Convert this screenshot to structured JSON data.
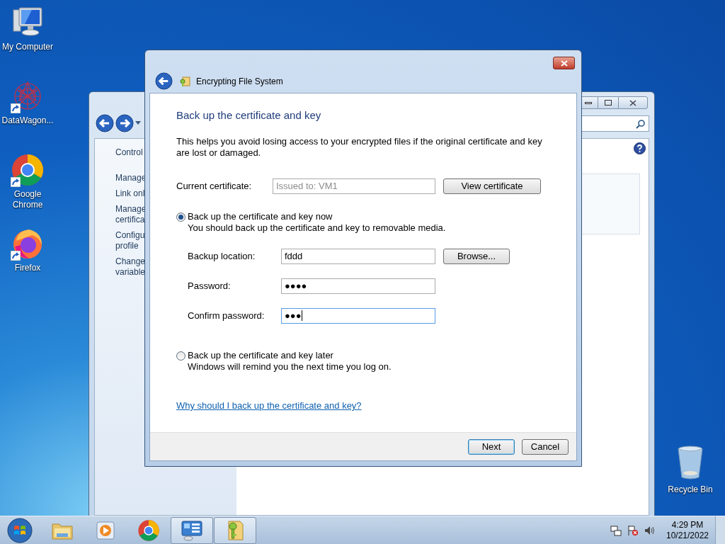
{
  "desktop": {
    "icons": [
      {
        "kind": "computer",
        "label": "My Computer",
        "shortcut": false
      },
      {
        "kind": "datawagon",
        "label": "DataWagon...",
        "shortcut": true
      },
      {
        "kind": "chrome",
        "label": "Google Chrome",
        "shortcut": true
      },
      {
        "kind": "firefox",
        "label": "Firefox",
        "shortcut": true
      }
    ],
    "recycle_bin": {
      "label": "Recycle Bin"
    }
  },
  "control_panel_window": {
    "left_pane": {
      "items": [
        {
          "lines": [
            "Control"
          ]
        },
        {
          "lines": [
            "Manage"
          ]
        },
        {
          "lines": [
            "Link onl"
          ]
        },
        {
          "lines": [
            "Manage",
            "certifica"
          ]
        },
        {
          "lines": [
            "Configu",
            "profile"
          ]
        },
        {
          "lines": [
            "Change",
            "variable"
          ]
        }
      ]
    }
  },
  "dialog": {
    "title": "Encrypting File System",
    "heading": "Back up the certificate and key",
    "description": "This helps you avoid losing access to your encrypted files if the original certificate and key are lost or damaged.",
    "current_certificate": {
      "label": "Current certificate:",
      "value": "Issued to: VM1",
      "disabled": true,
      "button": "View certificate"
    },
    "options": [
      {
        "label": "Back up the certificate and key now",
        "description": "You should back up the certificate and key to removable media.",
        "selected": true,
        "fields": [
          {
            "kind": "location",
            "label": "Backup location:",
            "value": "fddd",
            "button": "Browse...",
            "focused": false
          },
          {
            "kind": "password",
            "label": "Password:",
            "value": "●●●●",
            "focused": false
          },
          {
            "kind": "password",
            "label": "Confirm password:",
            "value": "●●●",
            "focused": true
          }
        ]
      },
      {
        "label": "Back up the certificate and key later",
        "description": "Windows will remind you the next time you log on.",
        "selected": false
      }
    ],
    "link": "Why should I back up the certificate and key?",
    "buttons": [
      {
        "label": "Next",
        "default": true
      },
      {
        "label": "Cancel",
        "default": false
      }
    ]
  },
  "taskbar": {
    "apps": [
      {
        "kind": "explorer",
        "open": false
      },
      {
        "kind": "media",
        "open": false
      },
      {
        "kind": "chrome",
        "open": false
      },
      {
        "kind": "control-panel",
        "open": true
      },
      {
        "kind": "efs",
        "open": true
      }
    ],
    "clock": {
      "time": "4:29 PM",
      "date": "10/21/2022"
    }
  }
}
